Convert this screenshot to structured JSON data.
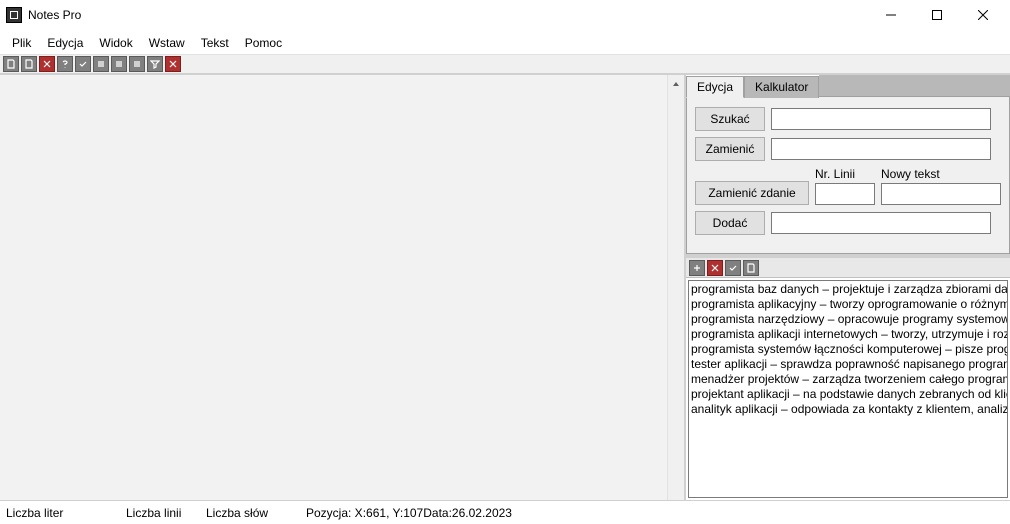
{
  "app": {
    "title": "Notes Pro"
  },
  "menu": [
    "Plik",
    "Edycja",
    "Widok",
    "Wstaw",
    "Tekst",
    "Pomoc"
  ],
  "toolbar_icons": [
    "doc-icon",
    "doc-icon",
    "close-icon",
    "help-icon",
    "check-icon",
    "align-left-icon",
    "align-center-icon",
    "align-right-icon",
    "filter-icon",
    "close-icon"
  ],
  "side": {
    "tabs": {
      "edit": "Edycja",
      "calc": "Kalkulator"
    },
    "buttons": {
      "search": "Szukać",
      "replace": "Zamienić",
      "replace_line": "Zamienić zdanie",
      "add": "Dodać"
    },
    "labels": {
      "line_no": "Nr. Linii",
      "new_text": "Nowy tekst"
    },
    "fields": {
      "search": "",
      "replace": "",
      "line_no": "",
      "new_text": "",
      "add": ""
    }
  },
  "sub_toolbar_icons": [
    "plus-icon",
    "close-icon",
    "check-icon",
    "save-icon"
  ],
  "list": [
    "programista baz danych – projektuje i zarządza zbiorami dany",
    "programista aplikacyjny – tworzy oprogramowanie o różnym",
    "programista narzędziowy – opracowuje programy systemowe",
    "programista aplikacji internetowych – tworzy, utrzymuje i roz",
    "programista systemów łączności komputerowej – pisze progr",
    "tester aplikacji – sprawdza poprawność napisanego programu",
    "menadżer projektów – zarządza tworzeniem całego programu",
    "projektant aplikacji – na podstawie danych zebranych od klie",
    "analityk aplikacji – odpowiada za kontakty z klientem, analizu"
  ],
  "status": {
    "letters": "Liczba liter",
    "lines": "Liczba linii",
    "words": "Liczba słów",
    "pos_prefix": "Pozycja: X: ",
    "pos_x": "661",
    "pos_mid": ", Y: ",
    "pos_y": "107",
    "date_prefix": "  Data: ",
    "date": "26.02.2023"
  }
}
